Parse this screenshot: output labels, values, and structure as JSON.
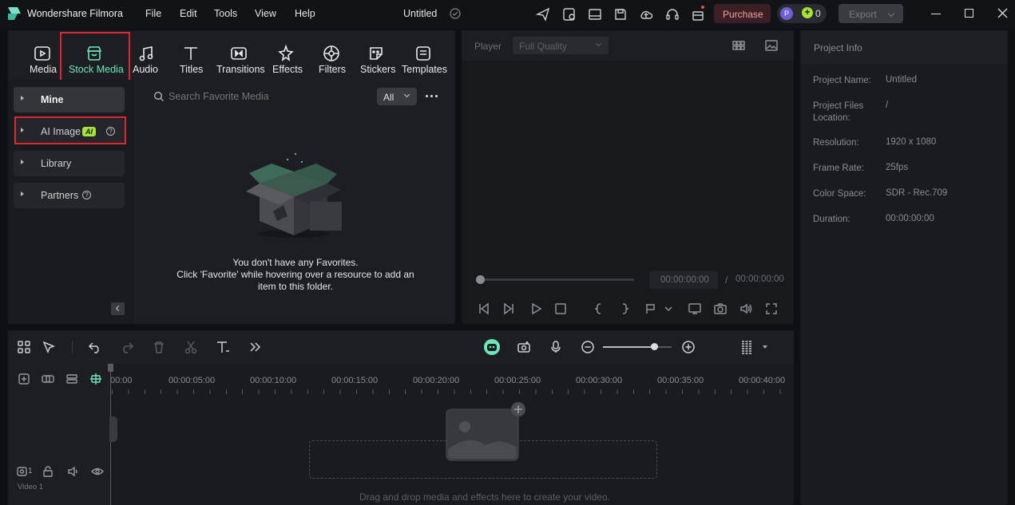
{
  "app": {
    "title": "Wondershare Filmora",
    "project_title": "Untitled"
  },
  "menu": [
    "File",
    "Edit",
    "Tools",
    "View",
    "Help"
  ],
  "toolbar": {
    "purchase_label": "Purchase",
    "avatar_letter": "P",
    "credits": "0",
    "export_label": "Export"
  },
  "tabs": [
    {
      "label": "Media",
      "icon": "media-icon"
    },
    {
      "label": "Stock Media",
      "icon": "stock-media-icon",
      "active": true
    },
    {
      "label": "Audio",
      "icon": "music-note-icon"
    },
    {
      "label": "Titles",
      "icon": "text-t-icon"
    },
    {
      "label": "Transitions",
      "icon": "transitions-icon"
    },
    {
      "label": "Effects",
      "icon": "effects-icon"
    },
    {
      "label": "Filters",
      "icon": "filters-icon"
    },
    {
      "label": "Stickers",
      "icon": "stickers-icon"
    },
    {
      "label": "Templates",
      "icon": "templates-icon"
    }
  ],
  "sidebar": {
    "items": [
      {
        "label": "Mine"
      },
      {
        "label": "AI Image",
        "badge": "AI"
      },
      {
        "label": "Library"
      },
      {
        "label": "Partners"
      }
    ]
  },
  "media": {
    "search_placeholder": "Search Favorite Media",
    "filter_value": "All",
    "empty_line1": "You don't have any Favorites.",
    "empty_line2": "Click 'Favorite' while hovering over a resource to add an",
    "empty_line3": "item to this folder."
  },
  "player": {
    "label": "Player",
    "quality": "Full Quality",
    "current_time": "00:00:00:00",
    "separator": "/",
    "total_time": "00:00:00:00"
  },
  "project_info": {
    "title": "Project Info",
    "rows": [
      {
        "key": "Project Name:",
        "value": "Untitled"
      },
      {
        "key": "Project Files Location:",
        "value": "/"
      },
      {
        "key": "Resolution:",
        "value": "1920 x 1080"
      },
      {
        "key": "Frame Rate:",
        "value": "25fps"
      },
      {
        "key": "Color Space:",
        "value": "SDR - Rec.709"
      },
      {
        "key": "Duration:",
        "value": "00:00:00:00"
      }
    ]
  },
  "timeline": {
    "ruler": [
      "00:00",
      "00:00:05:00",
      "00:00:10:00",
      "00:00:15:00",
      "00:00:20:00",
      "00:00:25:00",
      "00:00:30:00",
      "00:00:35:00",
      "00:00:40:00"
    ],
    "track_label": "Video 1",
    "track_number": "1",
    "drop_hint": "Drag and drop media and effects here to create your video.",
    "zoom_level": 0.75
  },
  "colors": {
    "accent": "#6ee7b7",
    "highlight_box": "#e0262e",
    "purchase_bg": "#3b1f25",
    "ai_badge": "#a3e635"
  }
}
